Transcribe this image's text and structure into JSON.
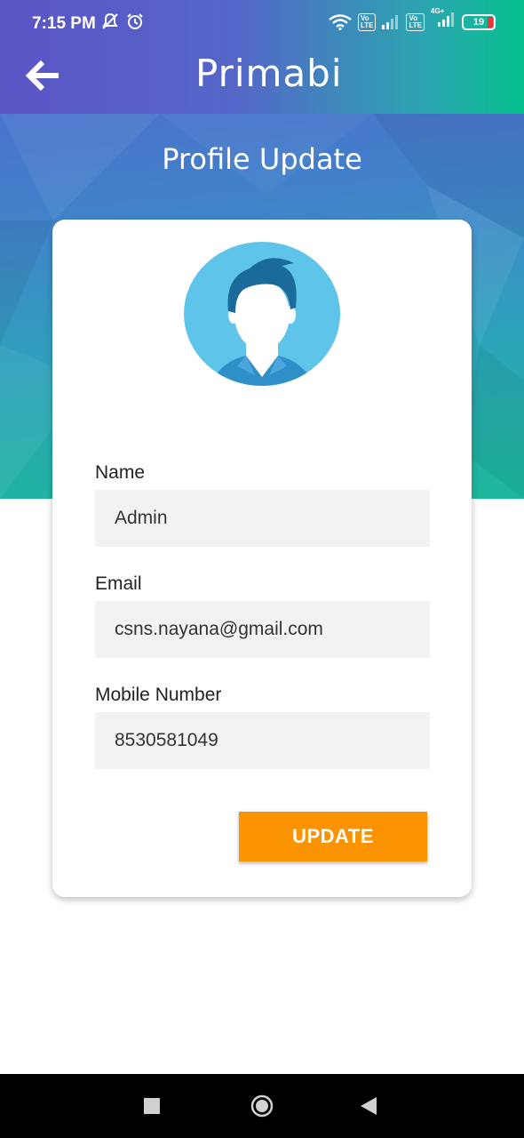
{
  "status_bar": {
    "time": "7:15 PM",
    "left_icons": [
      "mute-icon",
      "alarm-icon"
    ],
    "right_icons": [
      "wifi-icon",
      "volte-sim1-icon",
      "signal-sim1-icon",
      "volte-sim2-icon",
      "signal-4g-sim2-icon"
    ],
    "volte_label": "Vo\nLTE",
    "network_label": "4G+",
    "battery": "19",
    "battery_color": "#e8363a"
  },
  "app_bar": {
    "back_icon": "arrow-left-icon",
    "brand": "Primabi"
  },
  "page": {
    "title": "Profile Update"
  },
  "profile": {
    "avatar_icon": "user-avatar-icon",
    "fields": [
      {
        "label": "Name",
        "value": "Admin"
      },
      {
        "label": "Email",
        "value": "csns.nayana@gmail.com"
      },
      {
        "label": "Mobile Number",
        "value": "8530581049"
      }
    ],
    "update_label": "UPDATE"
  },
  "nav_bar": {
    "recents_icon": "square-icon",
    "home_icon": "circle-icon",
    "back_icon": "triangle-back-icon"
  },
  "colors": {
    "accent": "#fb9200",
    "gradient_start": "#5c55c6",
    "gradient_end": "#06c08d"
  }
}
